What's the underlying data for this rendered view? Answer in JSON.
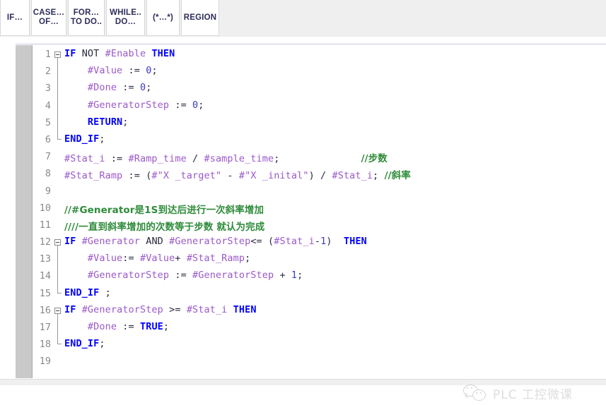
{
  "toolbar": {
    "buttons": [
      {
        "name": "if-block",
        "line1": "IF…",
        "line2": ""
      },
      {
        "name": "case-of-block",
        "line1": "CASE…",
        "line2": "OF…"
      },
      {
        "name": "for-to-do-block",
        "line1": "FOR…",
        "line2": "TO DO.."
      },
      {
        "name": "while-do-block",
        "line1": "WHILE..",
        "line2": "DO…"
      },
      {
        "name": "comment-block",
        "line1": "(*…*)",
        "line2": ""
      },
      {
        "name": "region-block",
        "line1": "REGION",
        "line2": ""
      }
    ]
  },
  "editor": {
    "lines": [
      {
        "num": "1",
        "fold": "open",
        "tokens": [
          {
            "t": "IF",
            "c": "kw"
          },
          {
            "t": " ",
            "c": "pln"
          },
          {
            "t": "NOT",
            "c": "op"
          },
          {
            "t": " ",
            "c": "pln"
          },
          {
            "t": "#Enable",
            "c": "var"
          },
          {
            "t": " ",
            "c": "pln"
          },
          {
            "t": "THEN",
            "c": "kw"
          }
        ]
      },
      {
        "num": "2",
        "fold": "none",
        "tokens": [
          {
            "t": "    #Value",
            "c": "var"
          },
          {
            "t": " := ",
            "c": "op"
          },
          {
            "t": "0",
            "c": "num"
          },
          {
            "t": ";",
            "c": "op"
          }
        ]
      },
      {
        "num": "3",
        "fold": "none",
        "tokens": [
          {
            "t": "    #Done",
            "c": "var"
          },
          {
            "t": " := ",
            "c": "op"
          },
          {
            "t": "0",
            "c": "num"
          },
          {
            "t": ";",
            "c": "op"
          }
        ]
      },
      {
        "num": "4",
        "fold": "none",
        "tokens": [
          {
            "t": "    #GeneratorStep",
            "c": "var"
          },
          {
            "t": " := ",
            "c": "op"
          },
          {
            "t": "0",
            "c": "num"
          },
          {
            "t": ";",
            "c": "op"
          }
        ]
      },
      {
        "num": "5",
        "fold": "none",
        "tokens": [
          {
            "t": "    ",
            "c": "pln"
          },
          {
            "t": "RETURN",
            "c": "kw"
          },
          {
            "t": ";",
            "c": "op"
          }
        ]
      },
      {
        "num": "6",
        "fold": "end",
        "tokens": [
          {
            "t": "END_IF",
            "c": "kw"
          },
          {
            "t": ";",
            "c": "op"
          }
        ]
      },
      {
        "num": "7",
        "fold": "none",
        "tokens": [
          {
            "t": "#Stat_i",
            "c": "var"
          },
          {
            "t": " := ",
            "c": "op"
          },
          {
            "t": "#Ramp_time",
            "c": "var"
          },
          {
            "t": " / ",
            "c": "op"
          },
          {
            "t": "#sample_time",
            "c": "var"
          },
          {
            "t": ";",
            "c": "op"
          },
          {
            "t": "              ",
            "c": "pln"
          },
          {
            "t": "//步数",
            "c": "cmt"
          }
        ]
      },
      {
        "num": "8",
        "fold": "none",
        "tokens": [
          {
            "t": "#Stat_Ramp",
            "c": "var"
          },
          {
            "t": " := (",
            "c": "op"
          },
          {
            "t": "#\"X _target\"",
            "c": "var"
          },
          {
            "t": " - ",
            "c": "op"
          },
          {
            "t": "#\"X _inital\"",
            "c": "var"
          },
          {
            "t": ") / ",
            "c": "op"
          },
          {
            "t": "#Stat_i",
            "c": "var"
          },
          {
            "t": "; ",
            "c": "op"
          },
          {
            "t": "//斜率",
            "c": "cmt"
          }
        ]
      },
      {
        "num": "9",
        "fold": "none",
        "tokens": []
      },
      {
        "num": "10",
        "fold": "none",
        "tokens": [
          {
            "t": "//#Generator是1S到达后进行一次斜率增加",
            "c": "cmt"
          }
        ]
      },
      {
        "num": "11",
        "fold": "none",
        "tokens": [
          {
            "t": "////一直到斜率增加的次数等于步数 就认为完成",
            "c": "cmt"
          }
        ]
      },
      {
        "num": "12",
        "fold": "open",
        "tokens": [
          {
            "t": "IF",
            "c": "kw"
          },
          {
            "t": " ",
            "c": "pln"
          },
          {
            "t": "#Generator",
            "c": "var"
          },
          {
            "t": " ",
            "c": "pln"
          },
          {
            "t": "AND",
            "c": "op"
          },
          {
            "t": " ",
            "c": "pln"
          },
          {
            "t": "#GeneratorStep",
            "c": "var"
          },
          {
            "t": "<= (",
            "c": "op"
          },
          {
            "t": "#Stat_i",
            "c": "var"
          },
          {
            "t": "-",
            "c": "op"
          },
          {
            "t": "1",
            "c": "num"
          },
          {
            "t": ")  ",
            "c": "op"
          },
          {
            "t": "THEN",
            "c": "kw"
          }
        ]
      },
      {
        "num": "13",
        "fold": "none",
        "tokens": [
          {
            "t": "    #Value",
            "c": "var"
          },
          {
            "t": ":= ",
            "c": "op"
          },
          {
            "t": "#Value",
            "c": "var"
          },
          {
            "t": "+ ",
            "c": "op"
          },
          {
            "t": "#Stat_Ramp",
            "c": "var"
          },
          {
            "t": ";",
            "c": "op"
          }
        ]
      },
      {
        "num": "14",
        "fold": "none",
        "tokens": [
          {
            "t": "    #GeneratorStep",
            "c": "var"
          },
          {
            "t": " := ",
            "c": "op"
          },
          {
            "t": "#GeneratorStep",
            "c": "var"
          },
          {
            "t": " + ",
            "c": "op"
          },
          {
            "t": "1",
            "c": "num"
          },
          {
            "t": ";",
            "c": "op"
          }
        ]
      },
      {
        "num": "15",
        "fold": "end",
        "tokens": [
          {
            "t": "END_IF",
            "c": "kw"
          },
          {
            "t": " ;",
            "c": "op"
          }
        ]
      },
      {
        "num": "16",
        "fold": "open",
        "tokens": [
          {
            "t": "IF",
            "c": "kw"
          },
          {
            "t": " ",
            "c": "pln"
          },
          {
            "t": "#GeneratorStep",
            "c": "var"
          },
          {
            "t": " >= ",
            "c": "op"
          },
          {
            "t": "#Stat_i",
            "c": "var"
          },
          {
            "t": " ",
            "c": "pln"
          },
          {
            "t": "THEN",
            "c": "kw"
          }
        ]
      },
      {
        "num": "17",
        "fold": "none",
        "tokens": [
          {
            "t": "    #Done",
            "c": "var"
          },
          {
            "t": " := ",
            "c": "op"
          },
          {
            "t": "TRUE",
            "c": "kw"
          },
          {
            "t": ";",
            "c": "op"
          }
        ]
      },
      {
        "num": "18",
        "fold": "end",
        "tokens": [
          {
            "t": "END_IF",
            "c": "kw"
          },
          {
            "t": ";",
            "c": "op"
          }
        ]
      },
      {
        "num": "19",
        "fold": "none",
        "tokens": []
      }
    ]
  },
  "watermark": {
    "icon": "wechat-icon",
    "text": "PLC 工控微课"
  },
  "colors": {
    "keyword": "#0000ff",
    "variable": "#9b59c9",
    "comment": "#2e8b3a",
    "operator": "#2b2b40",
    "gutter": "#c9c9c9",
    "toolbar_bg": "#efefef",
    "button_text": "#2d2d5a"
  }
}
